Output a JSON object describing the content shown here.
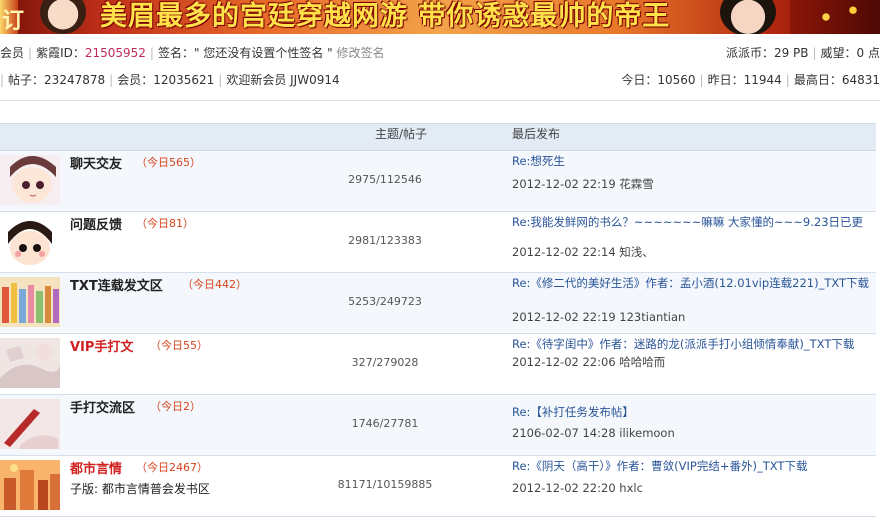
{
  "banner": {
    "left_glyph": "订",
    "text": "美眉最多的宫廷穿越网游 带你诱惑最帅的帝王",
    "star_icon": "star-icon"
  },
  "userbar": {
    "member_label": "会员",
    "member_id_label": "紫霞ID：",
    "member_id": "21505952",
    "signature_label": "签名：",
    "signature_text": "\" 您还没有设置个性签名 \"",
    "edit_signature": "修改签名",
    "coins": "派派币：29 PB",
    "prestige": "威望：0 点",
    "topics": "帖子：23247878",
    "members": "会员：12035621",
    "welcome": "欢迎新会员 JJW0914",
    "today": "今日：10560",
    "yesterday": "昨日：11944",
    "record": "最高日：64831"
  },
  "board": {
    "col_count": "主题/帖子",
    "col_last": "最后发布",
    "forums": [
      {
        "name": "聊天交友",
        "today": "（今日565）",
        "sub": "",
        "count": "2975/112546",
        "last_title": "Re:想死生",
        "last_meta": "2012-12-02 22:19 花霖雪",
        "thumb_color": "#f6e7ee"
      },
      {
        "name": "问题反馈",
        "today": "（今日81）",
        "sub": "",
        "count": "2981/123383",
        "last_title": "Re:我能发鲜网的书么？~~~~~~~嘛嘛 大家懂的~~~9.23日已更",
        "last_meta": "2012-12-02 22:14 知浅、",
        "thumb_color": "#fde8dc"
      },
      {
        "name": "TXT连载发文区",
        "today": "（今日442）",
        "sub": "",
        "count": "5253/249723",
        "last_title": "Re:《修二代的美好生活》作者：孟小酒(12.01vip连载221)_TXT下载",
        "last_meta": "2012-12-02 22:19 123tiantian",
        "thumb_color": "#f0c98a"
      },
      {
        "name": "VIP手打文",
        "today": "（今日55）",
        "sub": "",
        "count": "327/279028",
        "last_title": "Re:《待字闺中》作者：迷路的龙(派派手打小组倾情奉献)_TXT下载",
        "last_meta": "2012-12-02 22:06 哈哈哈而",
        "thumb_color": "#e9dfe0"
      },
      {
        "name": "手打交流区",
        "today": "（今日2）",
        "sub": "",
        "count": "1746/27781",
        "last_title": "Re:【补打任务发布帖】",
        "last_meta": "2106-02-07 14:28 ilikemoon",
        "thumb_color": "#ead3d3"
      },
      {
        "name": "都市言情",
        "today": "（今日2467）",
        "sub": "子版: 都市言情普会发书区",
        "count": "81171/10159885",
        "last_title": "Re:《阴天（高干）》作者：曹敛(VIP完结+番外)_TXT下载",
        "last_meta": "2012-12-02 22:20 hxlc",
        "thumb_color": "#f3a25e"
      }
    ]
  }
}
